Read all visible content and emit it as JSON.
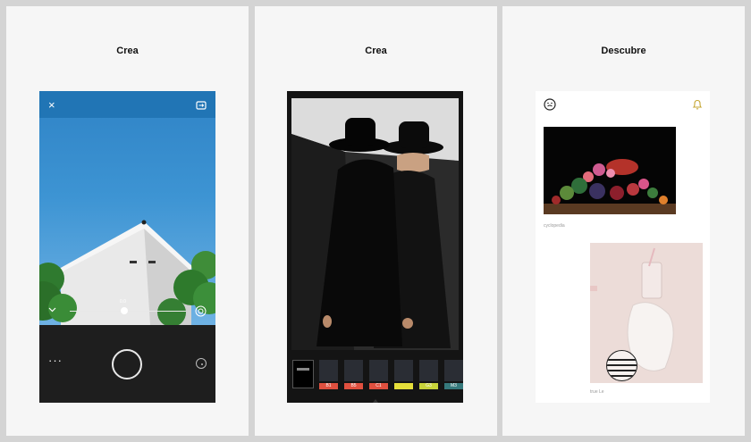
{
  "panels": [
    {
      "title": "Crea"
    },
    {
      "title": "Crea"
    },
    {
      "title": "Descubre"
    }
  ],
  "camera": {
    "close_icon": "×",
    "flip_icon": "flip-camera-icon",
    "slider_value": "0.0",
    "slider_fraction": 0.47,
    "more_label": "···"
  },
  "editor": {
    "filters": [
      {
        "label": "",
        "color": "#111111"
      },
      {
        "label": "B1",
        "color": "#e0503f"
      },
      {
        "label": "B5",
        "color": "#e0503f"
      },
      {
        "label": "C1",
        "color": "#e0503f"
      },
      {
        "label": "",
        "color": "#e5df3a"
      },
      {
        "label": "G3",
        "color": "#c8d43a"
      },
      {
        "label": "M3",
        "color": "#36797c"
      }
    ]
  },
  "discover": {
    "face_icon": "smiley-icon",
    "bell_icon": "bell-icon",
    "bell_color": "#c5a531",
    "posts": [
      {
        "caption": "cyclopedia"
      },
      {
        "caption": "true Le"
      }
    ]
  }
}
